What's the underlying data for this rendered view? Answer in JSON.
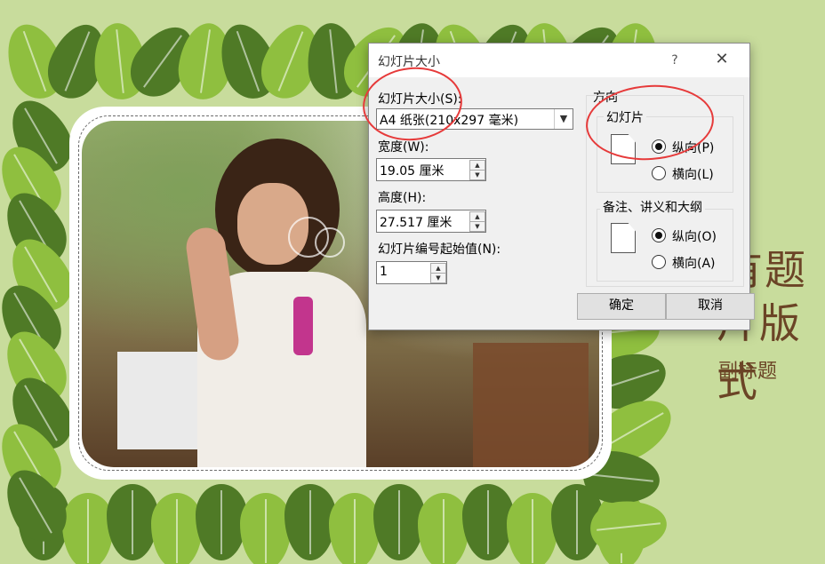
{
  "slide": {
    "title_fragment_line1": "有题",
    "title_fragment_line2": "片版式",
    "subtitle": "副标题"
  },
  "dialog": {
    "title": "幻灯片大小",
    "help_label": "?",
    "close_label": "✕",
    "slide_size": {
      "label": "幻灯片大小(S):",
      "value": "A4 纸张(210x297 毫米)",
      "dropdown_arrow": "▼"
    },
    "width": {
      "label": "宽度(W):",
      "value": "19.05 厘米"
    },
    "height": {
      "label": "高度(H):",
      "value": "27.517 厘米"
    },
    "start_number": {
      "label": "幻灯片编号起始值(N):",
      "value": "1"
    },
    "orientation": {
      "group_label": "方向",
      "slides": {
        "label": "幻灯片",
        "portrait_label": "纵向(P)",
        "landscape_label": "横向(L)",
        "selected": "portrait"
      },
      "notes": {
        "label": "备注、讲义和大纲",
        "portrait_label": "纵向(O)",
        "landscape_label": "横向(A)",
        "selected": "portrait"
      }
    },
    "ok_label": "确定",
    "cancel_label": "取消"
  },
  "colors": {
    "slide_bg": "#c8dc9c",
    "leaf_dark": "#4f7a26",
    "leaf_light": "#8fbf3f",
    "annotation_red": "#e63a3a",
    "title_text": "#6b4426"
  },
  "icons": {
    "spin_up": "▲",
    "spin_down": "▼"
  }
}
